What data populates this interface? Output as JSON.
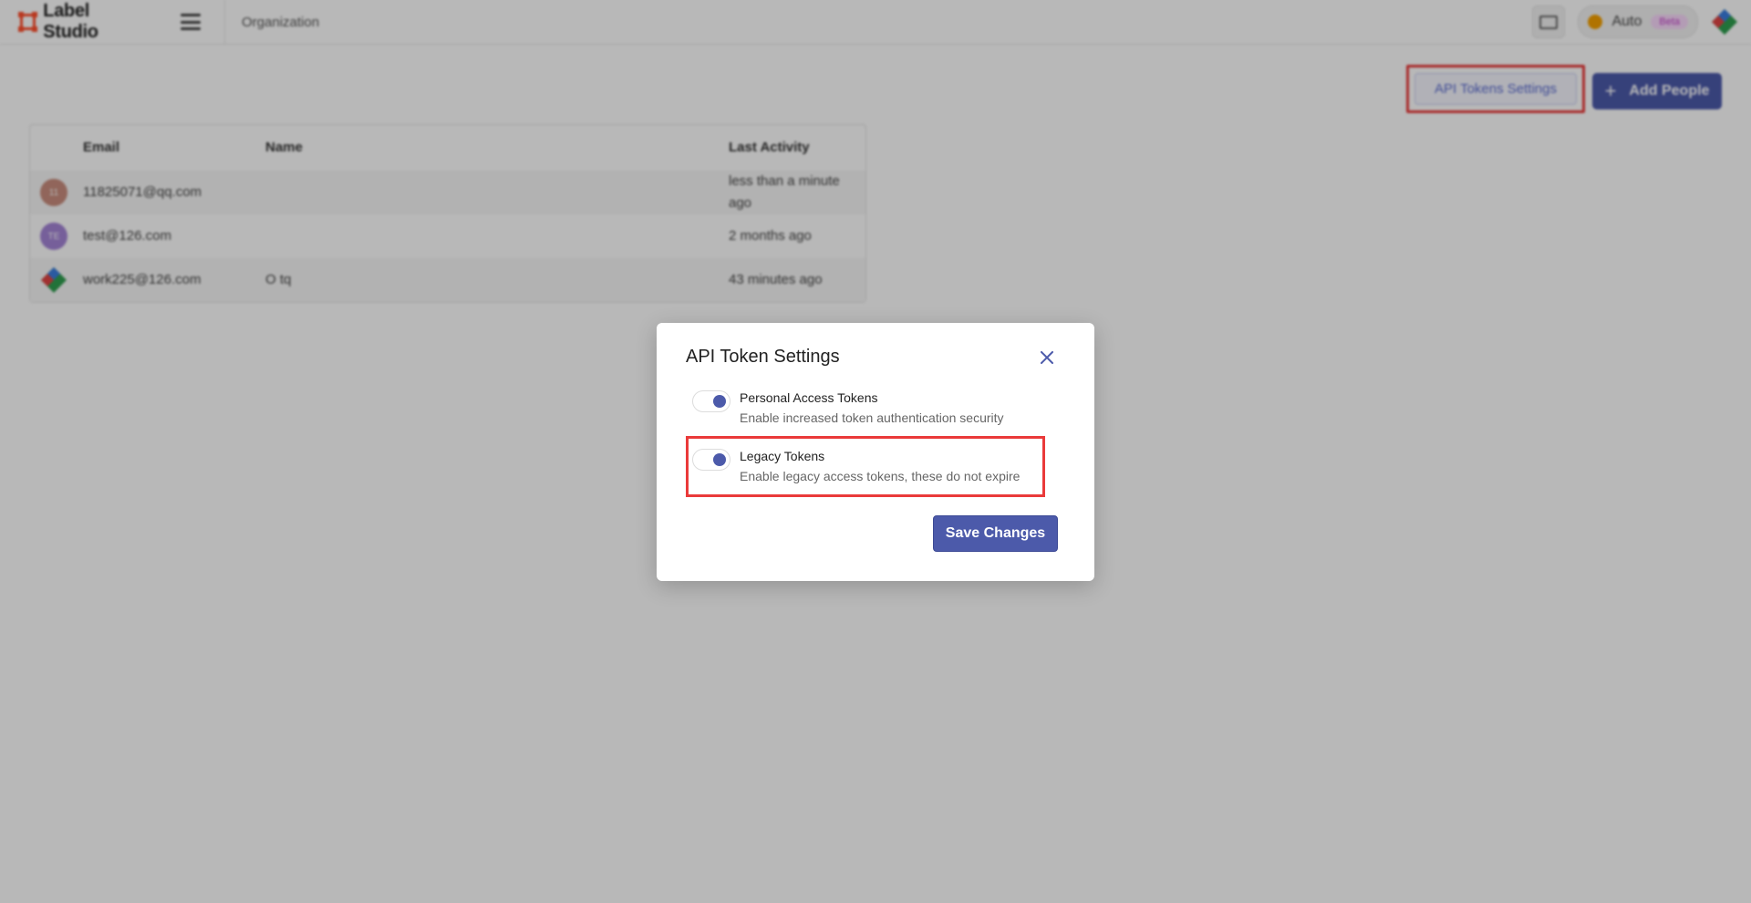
{
  "app": {
    "name": "Label Studio",
    "breadcrumb": "Organization"
  },
  "topbar": {
    "theme_label": "Auto",
    "beta_badge": "Beta"
  },
  "actions": {
    "api_tokens_settings": "API Tokens Settings",
    "add_people": "Add People"
  },
  "table": {
    "columns": [
      "Email",
      "Name",
      "Last Activity"
    ],
    "rows": [
      {
        "avatar": "11",
        "avatar_color": "#c98d7e",
        "email": "11825071@qq.com",
        "name": "",
        "last_activity_line1": "less than a minute",
        "last_activity_line2": "ago"
      },
      {
        "avatar": "TE",
        "avatar_color": "#a484d6",
        "email": "test@126.com",
        "name": "",
        "last_activity_line1": "2 months ago",
        "last_activity_line2": ""
      },
      {
        "avatar": "",
        "avatar_color": "",
        "email": "work225@126.com",
        "name": "O tq",
        "last_activity_line1": "43 minutes ago",
        "last_activity_line2": ""
      }
    ]
  },
  "modal": {
    "title": "API Token Settings",
    "settings": [
      {
        "label": "Personal Access Tokens",
        "description": "Enable increased token authentication security",
        "enabled": true
      },
      {
        "label": "Legacy Tokens",
        "description": "Enable legacy access tokens, these do not expire",
        "enabled": true
      }
    ],
    "save_label": "Save Changes"
  },
  "colors": {
    "primary": "#4c5aaa",
    "highlight": "#ea3a3a",
    "brand": "#ff4f2d"
  },
  "icons": {
    "logo": "label-studio-logo-icon",
    "menu": "hamburger-menu-icon",
    "monitor": "monitor-icon",
    "theme": "sun-icon",
    "add": "plus-icon",
    "close": "close-icon"
  }
}
